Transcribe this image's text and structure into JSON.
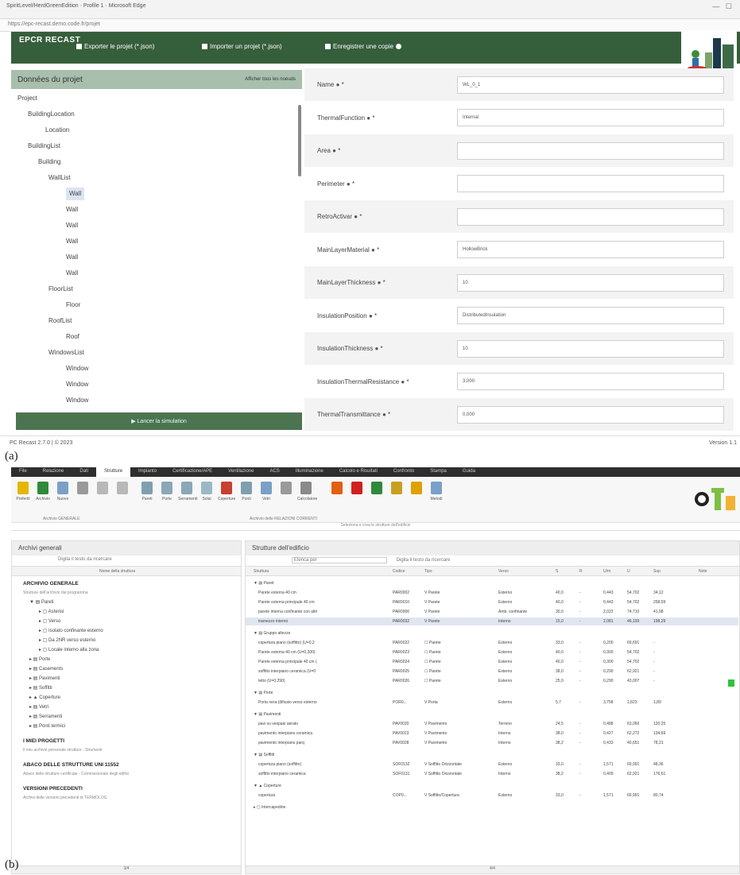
{
  "figure_a": {
    "caption": "(a)",
    "window_title": "SpiritLevel/HerdGreenEdition · Profile 1 · Microsoft Edge",
    "url": "https://epc-recast.demo.code.fr/projet",
    "app_logo": "EPCR RECAST",
    "nav": {
      "export_label": "Exporter le projet (*.json)",
      "import_label": "Importer un projet (*.json)",
      "save_label": "Enregistrer une copie"
    },
    "left_panel": {
      "title": "Données du projet",
      "action_label": "Afficher tous les noeuds",
      "tree": [
        {
          "label": "Project",
          "level": 0,
          "arrow": true
        },
        {
          "label": "BuildingLocation",
          "level": 1,
          "arrow": true
        },
        {
          "label": "Location",
          "level": 2,
          "arrow": false
        },
        {
          "label": "BuildingList",
          "level": 1,
          "arrow": true
        },
        {
          "label": "Building",
          "level": 2,
          "arrow": true
        },
        {
          "label": "WallList",
          "level": 3,
          "arrow": true
        },
        {
          "label": "Wall",
          "level": 4,
          "arrow": false,
          "selected": true
        },
        {
          "label": "Wall",
          "level": 4,
          "arrow": false
        },
        {
          "label": "Wall",
          "level": 4,
          "arrow": false
        },
        {
          "label": "Wall",
          "level": 4,
          "arrow": false
        },
        {
          "label": "Wall",
          "level": 4,
          "arrow": false
        },
        {
          "label": "Wall",
          "level": 4,
          "arrow": false
        },
        {
          "label": "FloorList",
          "level": 3,
          "arrow": true
        },
        {
          "label": "Floor",
          "level": 4,
          "arrow": false
        },
        {
          "label": "RoofList",
          "level": 3,
          "arrow": true
        },
        {
          "label": "Roof",
          "level": 4,
          "arrow": false
        },
        {
          "label": "WindowsList",
          "level": 3,
          "arrow": true
        },
        {
          "label": "Window",
          "level": 4,
          "arrow": false
        },
        {
          "label": "Window",
          "level": 4,
          "arrow": false
        },
        {
          "label": "Window",
          "level": 4,
          "arrow": false
        }
      ],
      "launch_label": "Lancer la simulation"
    },
    "fields": [
      {
        "label": "Name",
        "value": "WL_0_1"
      },
      {
        "label": "ThermalFunction",
        "value": "Internal"
      },
      {
        "label": "Area",
        "value": ""
      },
      {
        "label": "Perimeter",
        "value": ""
      },
      {
        "label": "RetroActivar",
        "value": ""
      },
      {
        "label": "MainLayerMaterial",
        "value": "HollowBrick"
      },
      {
        "label": "MainLayerThickness",
        "value": "10"
      },
      {
        "label": "InsulationPosition",
        "value": "DistributedInsulation"
      },
      {
        "label": "InsulationThickness",
        "value": "10"
      },
      {
        "label": "InsulationThermalResistance",
        "value": "3,000"
      },
      {
        "label": "ThermalTransmittance",
        "value": "0,000"
      }
    ],
    "footer": "PC Recast 2.7.0 | © 2023",
    "version": "Version 1.1"
  },
  "figure_b": {
    "caption": "(b)",
    "menu_tabs": [
      "File",
      "Relazione",
      "Dati",
      "Strutture",
      "Impianto",
      "Certificazione/APE",
      "Ventilazione",
      "ACS",
      "Illuminazione",
      "Calcolo e Risultati",
      "Confronto",
      "Stampa",
      "Guida"
    ],
    "active_tab": "Strutture",
    "ribbon_buttons": [
      "Preferiti",
      "Archivio",
      "Nuovo",
      "",
      "",
      "",
      "Pareti",
      "Porte",
      "Serramenti",
      "Solai",
      "Coperture",
      "Ponti",
      "Vetri",
      "",
      "Calcolatore",
      "",
      "",
      "",
      "",
      "",
      "Metodi"
    ],
    "ribbon_group_1": "Archivio GENERALE",
    "ribbon_group_2": "Archivio delle RELAZIONI CORRENTI",
    "ribbon_hint": "Seleziona e crea le strutture dell'edificio",
    "left_panel": {
      "title": "Archivi generali",
      "search_placeholder": "Digita il testo da ricercare",
      "col_header": "Nome della struttura",
      "rows": [
        {
          "t": "ARCHIVIO GENERALE",
          "c": "b"
        },
        {
          "t": "Strutture dell'archivio dal programma",
          "c": "s"
        },
        {
          "t": "▼ ▤ Pareti",
          "c": "i1"
        },
        {
          "t": "▸ ▢ Asterisi",
          "c": "i2"
        },
        {
          "t": "▸ ▢ Verso",
          "c": "i2"
        },
        {
          "t": "▸ ▢ Isolato confinante esterno",
          "c": "i2"
        },
        {
          "t": "▸ ▢ Da 2NR verso esterno",
          "c": "i2"
        },
        {
          "t": "▸ ▢ Locale interno alla zona",
          "c": "i2"
        },
        {
          "t": "▸ ▤ Porte",
          "c": "i1"
        },
        {
          "t": "▸ ▤ Casements",
          "c": "i1"
        },
        {
          "t": "▸ ▤ Pavimenti",
          "c": "i1"
        },
        {
          "t": "▸ ▤ Soffitti",
          "c": "i1"
        },
        {
          "t": "▸ ▲ Coperture",
          "c": "i1"
        },
        {
          "t": "▸ ▤ Vetri",
          "c": "i1"
        },
        {
          "t": "▸ ▤ Serramenti",
          "c": "i1"
        },
        {
          "t": "▸ ▤ Ponti termici",
          "c": "i1"
        },
        {
          "t": "I MIEI PROGETTI",
          "c": "b"
        },
        {
          "t": "Il mio archivio personale strutture - Strumenti",
          "c": "s"
        },
        {
          "t": "ABACO DELLE STRUTTURE UNI 11552",
          "c": "b"
        },
        {
          "t": "Abaco delle strutture certificate - Commissionale degli edifici",
          "c": "s"
        },
        {
          "t": "VERSIONI PRECEDENTI",
          "c": "b"
        },
        {
          "t": "Archivi delle versioni precedenti di TERMOLOG",
          "c": "s"
        }
      ],
      "status": "3/4"
    },
    "right_panel": {
      "title": "Strutture dell'edificio",
      "filter_value": "Elenca per",
      "search_placeholder": "Digita il testo da ricercare",
      "columns": [
        "Struttura",
        "Codice",
        "Tipo",
        "Verso",
        "S",
        "R",
        "U/m",
        "U",
        "Sup",
        "Note"
      ],
      "rows": [
        {
          "n": "▼ ▤ Pareti",
          "g": true
        },
        {
          "n": "Parete esterna 40 cm",
          "code": "PAR0002",
          "tipo": "V Parete",
          "verso": "Esterno",
          "s": "40,0",
          "r": "-",
          "um": "0,443",
          "u": "54,702",
          "sup": "34,12"
        },
        {
          "n": "Parete esterna principale 40 cm",
          "code": "PAR0010",
          "tipo": "V Parete",
          "verso": "Esterno",
          "s": "40,0",
          "r": "-",
          "um": "0,443",
          "u": "54,702",
          "sup": "258,59"
        },
        {
          "n": "parete interna confinante con altri",
          "code": "PAR0006",
          "tipo": "V Parete",
          "verso": "Amb. confinante",
          "s": "30,0",
          "r": "-",
          "um": "2,022",
          "u": "74,710",
          "sup": "41,98"
        },
        {
          "n": "tramezzo interno",
          "code": "PAR0032",
          "tipo": "V Parete",
          "verso": "Interno",
          "s": "15,0",
          "r": "-",
          "um": "2,081",
          "u": "46,193",
          "sup": "198,29",
          "hl": true
        },
        {
          "n": "▼ ▤ Gruppo altezze",
          "g": true
        },
        {
          "n": "copertura piano (soffitto) (U=0,2",
          "code": "PAR0022",
          "tipo": "☐ Parete",
          "verso": "Esterno",
          "s": "33,0",
          "r": "-",
          "um": "0,200",
          "u": "69,691",
          "sup": "-"
        },
        {
          "n": "Parete esterna 40 cm (U=0,300)",
          "code": "PAR0023",
          "tipo": "☐ Parete",
          "verso": "Esterno",
          "s": "40,0",
          "r": "-",
          "um": "0,300",
          "u": "54,702",
          "sup": "-"
        },
        {
          "n": "Parete esterna principale 40 cm (",
          "code": "PAR0024",
          "tipo": "☐ Parete",
          "verso": "Esterno",
          "s": "40,0",
          "r": "-",
          "um": "0,300",
          "u": "54,702",
          "sup": "-"
        },
        {
          "n": "soffitto interpiano ceramica (U=0",
          "code": "PAR0025",
          "tipo": "☐ Parete",
          "verso": "Esterno",
          "s": "38,0",
          "r": "-",
          "um": "0,290",
          "u": "62,921",
          "sup": "-"
        },
        {
          "n": "tetto (U=0,290)",
          "code": "PAR0026",
          "tipo": "☐ Parete",
          "verso": "Esterno",
          "s": "25,0",
          "r": "-",
          "um": "0,290",
          "u": "43,007",
          "sup": "-"
        },
        {
          "n": "▼ ▤ Porte",
          "g": true
        },
        {
          "n": "Porta nera (difiusio verso esterno",
          "code": "POR0...",
          "tipo": "V Porta",
          "verso": "Esterno",
          "s": "5,7",
          "r": "-",
          "um": "3,758",
          "u": "1,823",
          "sup": "1,89"
        },
        {
          "n": "▼ ▤ Pavimenti",
          "g": true
        },
        {
          "n": "pavi su vespaio aerato",
          "code": "PAV0020",
          "tipo": "V Pavimento",
          "verso": "Terreno",
          "s": "24,5",
          "r": "-",
          "um": "0,488",
          "u": "63,060",
          "sup": "120,25"
        },
        {
          "n": "pavimento interpiano ceramica",
          "code": "PAV0023",
          "tipo": "V Pavimento",
          "verso": "Interno",
          "s": "38,0",
          "r": "-",
          "um": "0,427",
          "u": "62,272",
          "sup": "134,69"
        },
        {
          "n": "pavimento interpiano parq",
          "code": "PAV0028",
          "tipo": "V Pavimento",
          "verso": "Interno",
          "s": "38,2",
          "r": "-",
          "um": "0,433",
          "u": "40,651",
          "sup": "78,21"
        },
        {
          "n": "▼ ▤ Soffitti",
          "g": true
        },
        {
          "n": "copertura piano (soffitto)",
          "code": "SOF0132",
          "tipo": "V Soffitto Orizzontale",
          "verso": "Esterno",
          "s": "33,0",
          "r": "-",
          "um": "1,571",
          "u": "69,991",
          "sup": "48,36"
        },
        {
          "n": "soffitto interpiano ceramica",
          "code": "SOF0131",
          "tipo": "V Soffitto Orizzontale",
          "verso": "Interno",
          "s": "38,2",
          "r": "-",
          "um": "0,409",
          "u": "62,921",
          "sup": "176,61"
        },
        {
          "n": "▼ ▲ Coperture",
          "g": true
        },
        {
          "n": "copertura",
          "code": "COP0...",
          "tipo": "V Soffitto/Copertura",
          "verso": "Esterno",
          "s": "33,0",
          "r": "-",
          "um": "1,571",
          "u": "69,991",
          "sup": "80,74"
        },
        {
          "n": "▸ ▢ Intercapedine",
          "g": true
        }
      ],
      "status": "4/4"
    }
  }
}
